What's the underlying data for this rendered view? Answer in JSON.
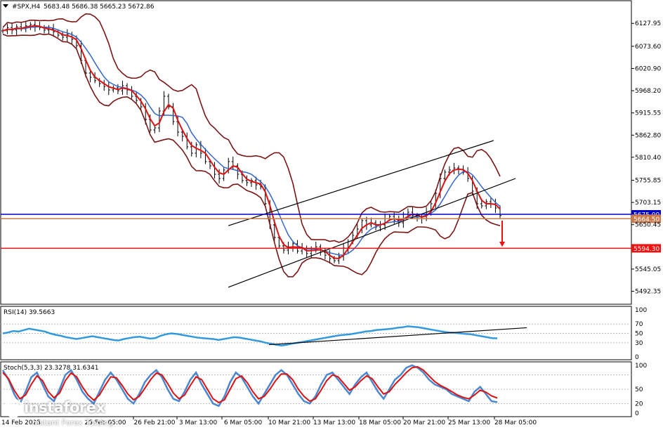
{
  "chart_data": [
    {
      "type": "candlestick",
      "title": "#SPX,H4",
      "ohlc_header": "5683.48 5686.38 5665.23 5672.86",
      "ylim": [
        5470,
        6170
      ],
      "y_ticks": [
        "6127.95",
        "6073.60",
        "6020.90",
        "5968.20",
        "5915.55",
        "5862.80",
        "5810.40",
        "5755.85",
        "5703.15",
        "5650.45",
        "5545.05",
        "5492.35"
      ],
      "x_ticks": [
        "26 Feb 21:00",
        "3 Mar 13:00",
        "6 Mar 05:00",
        "10 Mar 21:00",
        "13 Mar 13:00",
        "18 Mar 05:00",
        "20 Mar 21:00",
        "25 Mar 13:00",
        "28 Mar 05:00"
      ],
      "x_ticks_partial": [
        "14 Feb 2025",
        "25 Feb 05:00"
      ],
      "series_close": [
        6110,
        6118,
        6112,
        6120,
        6115,
        6122,
        6125,
        6120,
        6118,
        6112,
        6115,
        6108,
        6100,
        6095,
        6102,
        6090,
        6075,
        6040,
        6010,
        6000,
        5992,
        5985,
        5978,
        5970,
        5975,
        5968,
        5980,
        5970,
        5955,
        5945,
        5930,
        5900,
        5875,
        5880,
        5920,
        5955,
        5930,
        5895,
        5870,
        5860,
        5835,
        5820,
        5840,
        5820,
        5800,
        5790,
        5770,
        5760,
        5780,
        5800,
        5790,
        5770,
        5755,
        5750,
        5755,
        5745,
        5740,
        5700,
        5650,
        5620,
        5600,
        5590,
        5598,
        5605,
        5588,
        5595,
        5582,
        5590,
        5598,
        5585,
        5578,
        5570,
        5565,
        5575,
        5595,
        5610,
        5625,
        5640,
        5660,
        5650,
        5655,
        5645,
        5650,
        5665,
        5670,
        5660,
        5655,
        5675,
        5680,
        5672,
        5668,
        5665,
        5680,
        5700,
        5725,
        5760,
        5775,
        5780,
        5785,
        5782,
        5775,
        5760,
        5730,
        5700,
        5695,
        5705,
        5700,
        5690,
        5672
      ],
      "levels": [
        {
          "value": 5675.0,
          "label": "5675.00",
          "color": "#0000cc"
        },
        {
          "value": 5664.5,
          "label": "5664.50",
          "color": "#c87a4a"
        },
        {
          "value": 5594.3,
          "label": "5594.30",
          "color": "#ee1111"
        }
      ],
      "channel": {
        "lower_start": [
          5502,
          72
        ],
        "lower_end": [
          5760,
          124
        ],
        "upper_start": [
          5648,
          72
        ],
        "upper_end": [
          5850,
          117
        ]
      },
      "colors": {
        "price": "#000000",
        "bollinger": "#7a1515",
        "ma_fast": "#dd1111",
        "ma_slow": "#3366cc",
        "arrow": "#ee1111"
      }
    },
    {
      "type": "line",
      "title": "RSI(14) 39.5663",
      "ylim": [
        0,
        100
      ],
      "y_ticks": [
        "100",
        "70",
        "50",
        "30",
        "0"
      ],
      "values": [
        50,
        52,
        55,
        54,
        57,
        60,
        58,
        56,
        54,
        50,
        47,
        45,
        42,
        40,
        38,
        40,
        42,
        44,
        42,
        40,
        38,
        36,
        35,
        38,
        40,
        42,
        43,
        41,
        39,
        40,
        45,
        48,
        50,
        49,
        47,
        45,
        43,
        41,
        40,
        39,
        38,
        36,
        38,
        40,
        42,
        41,
        39,
        37,
        35,
        33,
        30,
        28,
        26,
        24,
        26,
        28,
        30,
        32,
        34,
        36,
        38,
        40,
        42,
        44,
        46,
        47,
        48,
        50,
        52,
        54,
        55,
        57,
        58,
        59,
        60,
        62,
        63,
        65,
        64,
        63,
        61,
        59,
        57,
        55,
        53,
        52,
        51,
        50,
        49,
        48,
        46,
        44,
        42,
        40,
        39.6
      ],
      "trendline": [
        [
          383,
          8
        ],
        [
          750,
          124
        ]
      ],
      "color": "#3399dd"
    },
    {
      "type": "line",
      "title": "Stoch(5,3,3) 23.3278 31.6341",
      "ylim": [
        0,
        100
      ],
      "y_ticks": [
        "100",
        "50",
        "20",
        "0"
      ],
      "series": [
        {
          "values": [
            90,
            70,
            40,
            20,
            45,
            75,
            85,
            60,
            35,
            25,
            50,
            80,
            90,
            70,
            45,
            30,
            20,
            45,
            70,
            85,
            70,
            50,
            30,
            20,
            40,
            65,
            80,
            90,
            75,
            50,
            30,
            25,
            45,
            70,
            85,
            60,
            40,
            20,
            15,
            35,
            65,
            85,
            75,
            55,
            35,
            20,
            40,
            60,
            80,
            90,
            80,
            60,
            40,
            25,
            20,
            35,
            60,
            80,
            85,
            70,
            55,
            40,
            60,
            75,
            85,
            65,
            45,
            30,
            50,
            70,
            80,
            95,
            100,
            95,
            85,
            70,
            60,
            55,
            50,
            40,
            35,
            30,
            25,
            45,
            55,
            40,
            25,
            23
          ],
          "color": "#4a87d0"
        },
        {
          "values": [
            85,
            72,
            48,
            30,
            38,
            60,
            78,
            68,
            45,
            32,
            42,
            68,
            84,
            76,
            55,
            38,
            27,
            38,
            58,
            76,
            74,
            58,
            40,
            28,
            35,
            52,
            70,
            84,
            80,
            62,
            42,
            30,
            38,
            58,
            76,
            70,
            50,
            30,
            22,
            28,
            50,
            72,
            78,
            64,
            45,
            30,
            35,
            50,
            68,
            82,
            82,
            70,
            50,
            35,
            25,
            30,
            48,
            68,
            80,
            76,
            62,
            48,
            55,
            68,
            78,
            72,
            55,
            40,
            45,
            60,
            72,
            85,
            95,
            97,
            90,
            78,
            66,
            58,
            52,
            45,
            38,
            33,
            30,
            38,
            48,
            44,
            36,
            31.6
          ],
          "color": "#dd1111"
        }
      ]
    }
  ],
  "logo": {
    "name": "instaforex",
    "tagline": "Instant Forex Trading"
  }
}
